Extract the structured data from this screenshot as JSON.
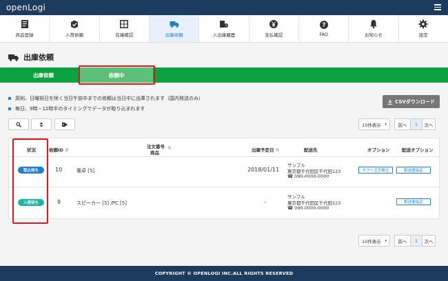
{
  "app": {
    "logo": "openLogi"
  },
  "nav": [
    {
      "label": "商品登録",
      "icon": "product-list-icon"
    },
    {
      "label": "入荷依頼",
      "icon": "box-check-icon"
    },
    {
      "label": "在庫確認",
      "icon": "warehouse-icon"
    },
    {
      "label": "出庫依頼",
      "icon": "truck-icon",
      "active": true
    },
    {
      "label": "入出庫履歴",
      "icon": "history-icon"
    },
    {
      "label": "支払確認",
      "icon": "yen-coin-icon"
    },
    {
      "label": "FAQ",
      "icon": "question-icon"
    },
    {
      "label": "お知らせ",
      "icon": "bell-icon"
    },
    {
      "label": "設定",
      "icon": "gear-icon"
    }
  ],
  "page": {
    "title": "出庫依頼"
  },
  "tabs": {
    "outgoing": "出庫依頼",
    "pending": "依頼中"
  },
  "notices": [
    "原則、日曜祝日を除く当日午前中までの依頼は当日中に出庫されます（国内発送のみ）",
    "毎日、9時・12時半のタイミングでデータが取り込まれます"
  ],
  "toolbar": {
    "csv_label": "CSVダウンロード"
  },
  "pagination": {
    "per_page": "10件表示",
    "prev": "前へ",
    "current": "1",
    "next": "次へ"
  },
  "table": {
    "headers": {
      "status": "状況",
      "request_id": "依頼ID",
      "order_no": "注文番号",
      "product": "商品",
      "ship_date": "出庫予定日",
      "destination": "配送先",
      "option": "オプション",
      "delivery_option": "配送オプション"
    },
    "rows": [
      {
        "status": "取込待ち",
        "status_color": "#1c7fd0",
        "id": "10",
        "product": "電卓 [5]",
        "date": "2018/01/11",
        "dest_name": "サンプル",
        "dest_addr": "東京都千代田区千代田123",
        "dest_tel": "☎ 090-0000-0000",
        "option_label": "ギフト注文単位",
        "delivery_label": "配送便指定"
      },
      {
        "status": "入荷待ち",
        "status_color": "#19b7a4",
        "id": "9",
        "product": "スピーカー [5] /PC [5]",
        "date": "-",
        "dest_name": "サンプル",
        "dest_addr": "東京都千代田区千代田123",
        "dest_tel": "☎ 090-0000-0000",
        "option_label": "",
        "delivery_label": "配送便指定"
      }
    ]
  },
  "footer": {
    "text": "COPYRIGHT © OPENLOGI INC.ALL RIGHTS RESERVED"
  },
  "colors": {
    "navy": "#1d3a5f",
    "green": "#0aa140",
    "highlight": "#e0161b",
    "blue": "#1c7fd0"
  }
}
